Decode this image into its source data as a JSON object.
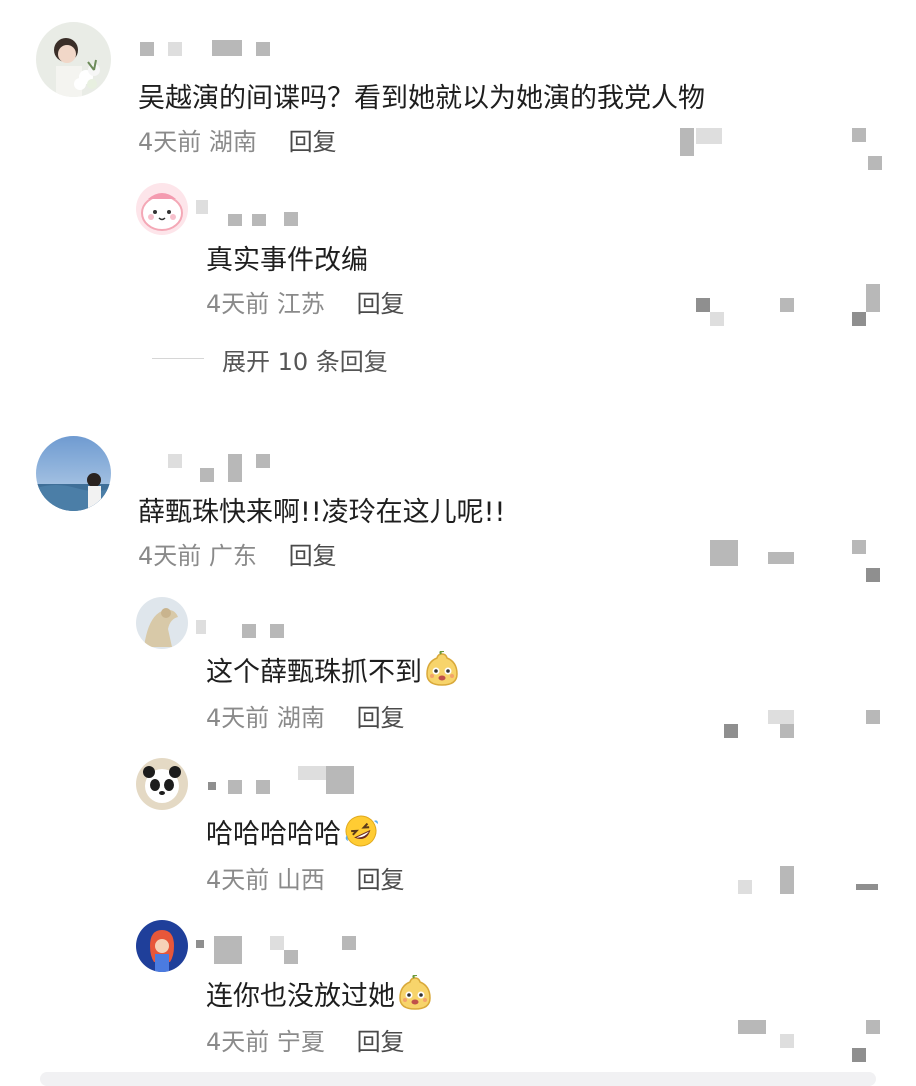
{
  "comments": [
    {
      "id": "c1",
      "text": "吴越演的间谍吗？看到她就以为她演的我党人物",
      "time": "4天前",
      "location": "湖南",
      "reply_label": "回复",
      "avatar_icon": "user-avatar-flowers",
      "replies": [
        {
          "text": "真实事件改编",
          "time": "4天前",
          "location": "江苏",
          "reply_label": "回复",
          "avatar_icon": "user-avatar-cartoon-pink"
        }
      ],
      "expand_label": "展开 10 条回复"
    },
    {
      "id": "c2",
      "text": "薛甄珠快来啊!!凌玲在这儿呢!!",
      "time": "4天前",
      "location": "广东",
      "reply_label": "回复",
      "avatar_icon": "user-avatar-sea",
      "replies": [
        {
          "text": "这个薛甄珠抓不到",
          "emoji": "pear-face-emoji",
          "time": "4天前",
          "location": "湖南",
          "reply_label": "回复",
          "avatar_icon": "user-avatar-sculpture"
        },
        {
          "text": "哈哈哈哈哈",
          "emoji": "rofl-emoji",
          "time": "4天前",
          "location": "山西",
          "reply_label": "回复",
          "avatar_icon": "user-avatar-panda"
        },
        {
          "text": "连你也没放过她",
          "emoji": "pear-face-emoji",
          "time": "4天前",
          "location": "宁夏",
          "reply_label": "回复",
          "avatar_icon": "user-avatar-girl-blue"
        }
      ]
    }
  ],
  "colors": {
    "meta_text": "#8a8a8a",
    "reply_text": "#4a4a4a",
    "body_text": "#1e1e1e",
    "censor_pixel": "#b8b8b8"
  }
}
